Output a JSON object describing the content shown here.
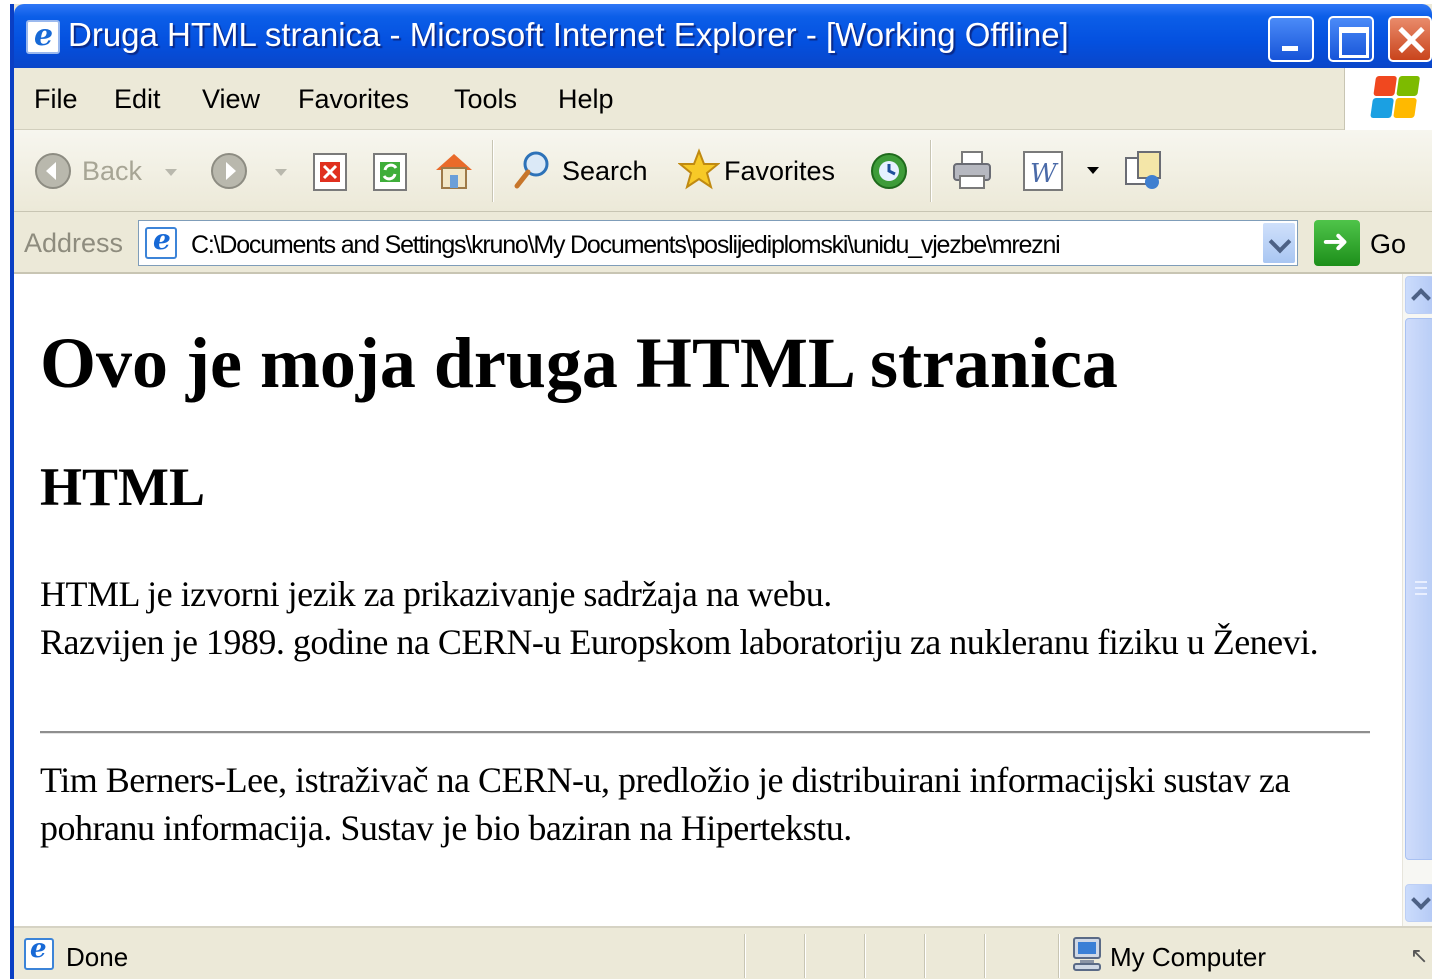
{
  "window": {
    "title": "Druga HTML stranica - Microsoft Internet Explorer - [Working Offline]"
  },
  "menu": {
    "file": "File",
    "edit": "Edit",
    "view": "View",
    "favorites": "Favorites",
    "tools": "Tools",
    "help": "Help"
  },
  "toolbar": {
    "back": "Back",
    "search": "Search",
    "favorites": "Favorites",
    "icons": [
      "back-icon",
      "forward-icon",
      "stop-icon",
      "refresh-icon",
      "home-icon",
      "search-icon",
      "favorites-star-icon",
      "history-icon",
      "print-icon",
      "edit-word-icon",
      "discuss-icon"
    ]
  },
  "address": {
    "label": "Address",
    "value": "C:\\Documents and Settings\\kruno\\My Documents\\poslijediplomski\\unidu_vjezbe\\mrezni",
    "go": "Go"
  },
  "page": {
    "h1": "Ovo je moja druga HTML stranica",
    "h2": "HTML",
    "p1_line1": "HTML je izvorni jezik za prikazivanje sadržaja na webu.",
    "p1_line2": "Razvijen je 1989. godine na CERN-u Europskom laboratoriju za nukleranu fiziku u Ženevi.",
    "p2": "Tim Berners-Lee, istraživač na CERN-u, predložio je distribuirani informacijski sustav za pohranu informacija. Sustav je bio baziran na Hipertekstu."
  },
  "status": {
    "text": "Done",
    "zone": "My Computer"
  },
  "colors": {
    "titlebar": "#0450df",
    "chrome": "#ece9d8",
    "close": "#c9441c"
  }
}
